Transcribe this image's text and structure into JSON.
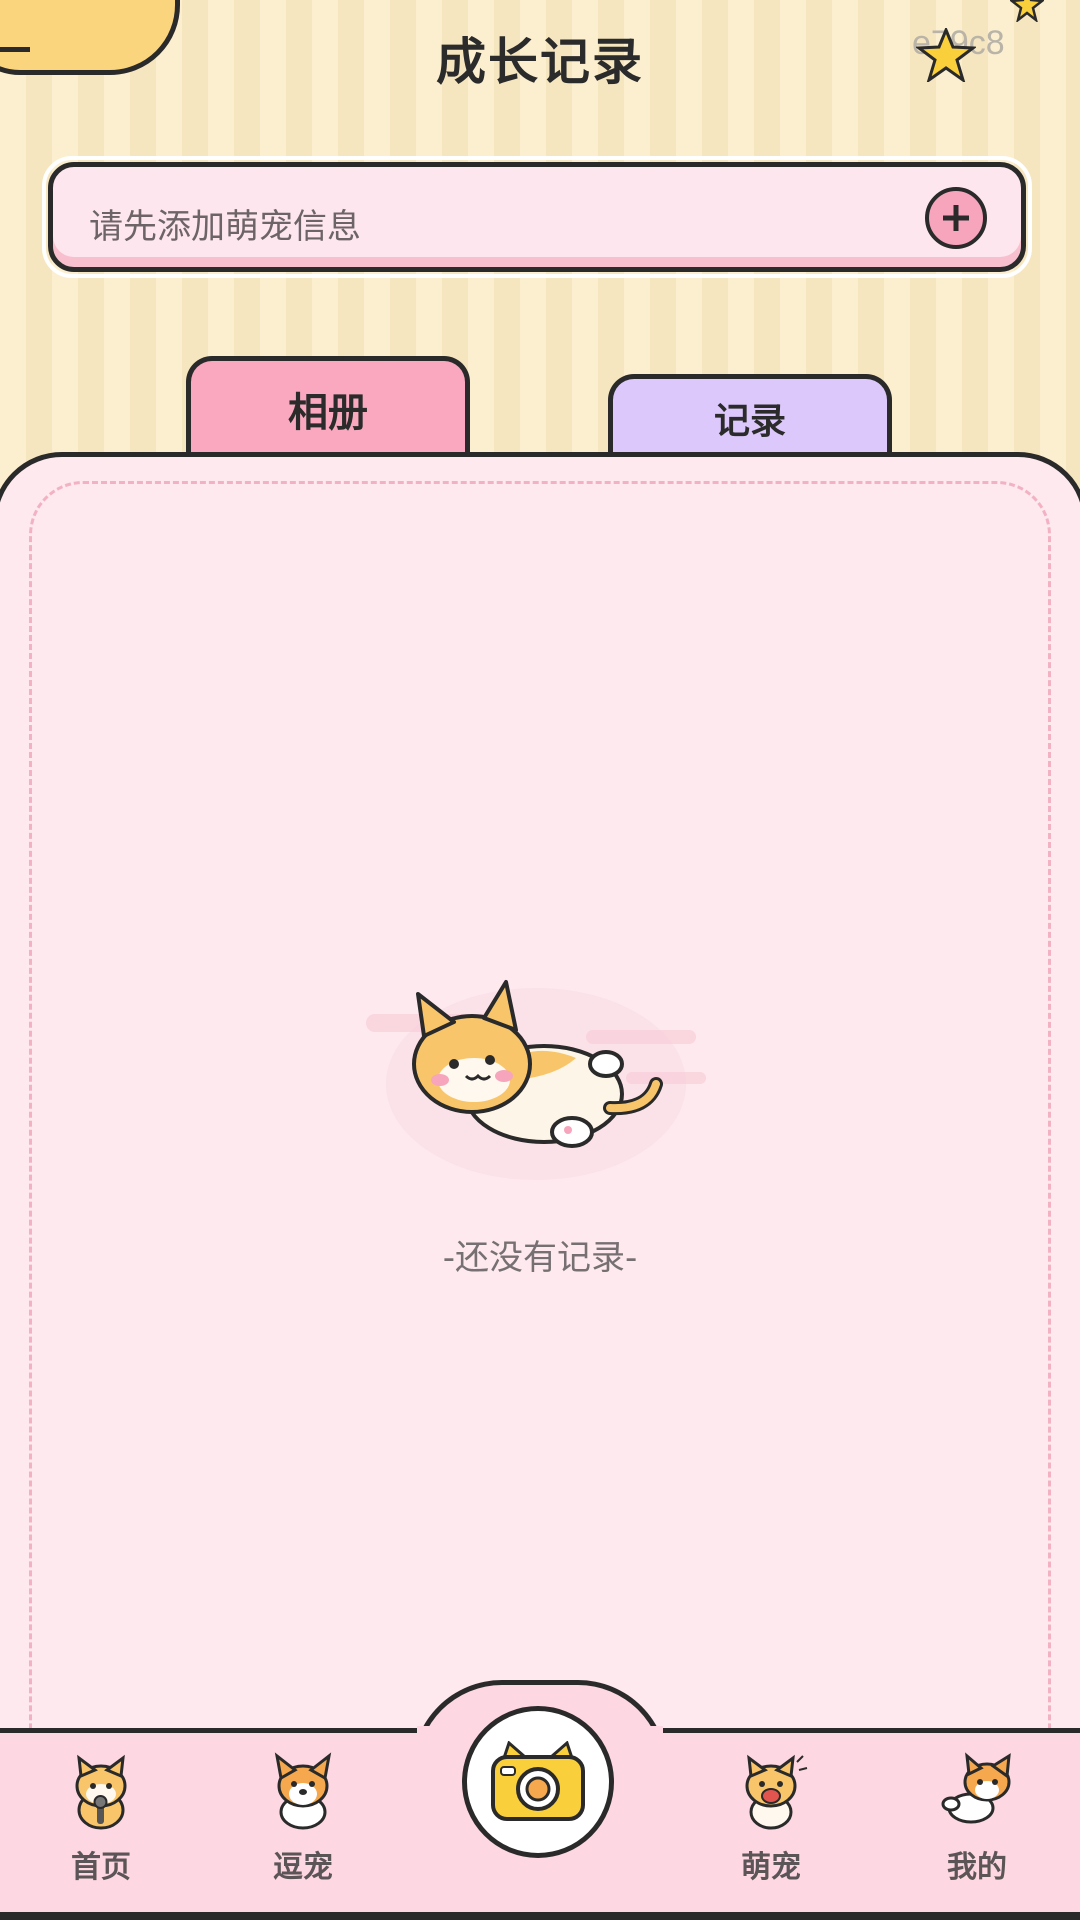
{
  "header": {
    "title": "成长记录",
    "corner_code": "e79c8"
  },
  "pet_bar": {
    "placeholder": "请先添加萌宠信息"
  },
  "tabs": [
    {
      "label": "相册",
      "active": true
    },
    {
      "label": "记录",
      "active": false
    }
  ],
  "empty_state": {
    "text": "-还没有记录-"
  },
  "bottom_nav": {
    "items": [
      {
        "label": "首页",
        "icon": "cat-microphone-icon"
      },
      {
        "label": "逗宠",
        "icon": "corgi-icon"
      },
      {
        "label": "",
        "icon": "camera-cat-icon"
      },
      {
        "label": "萌宠",
        "icon": "cat-cheer-icon"
      },
      {
        "label": "我的",
        "icon": "corgi-wave-icon"
      }
    ]
  },
  "colors": {
    "background": "#fbefd0",
    "card": "#fde9ee",
    "tab_album": "#f9a8bf",
    "tab_record": "#dcc8fb",
    "nav": "#fdd7e2",
    "outline": "#2a2a2a"
  }
}
